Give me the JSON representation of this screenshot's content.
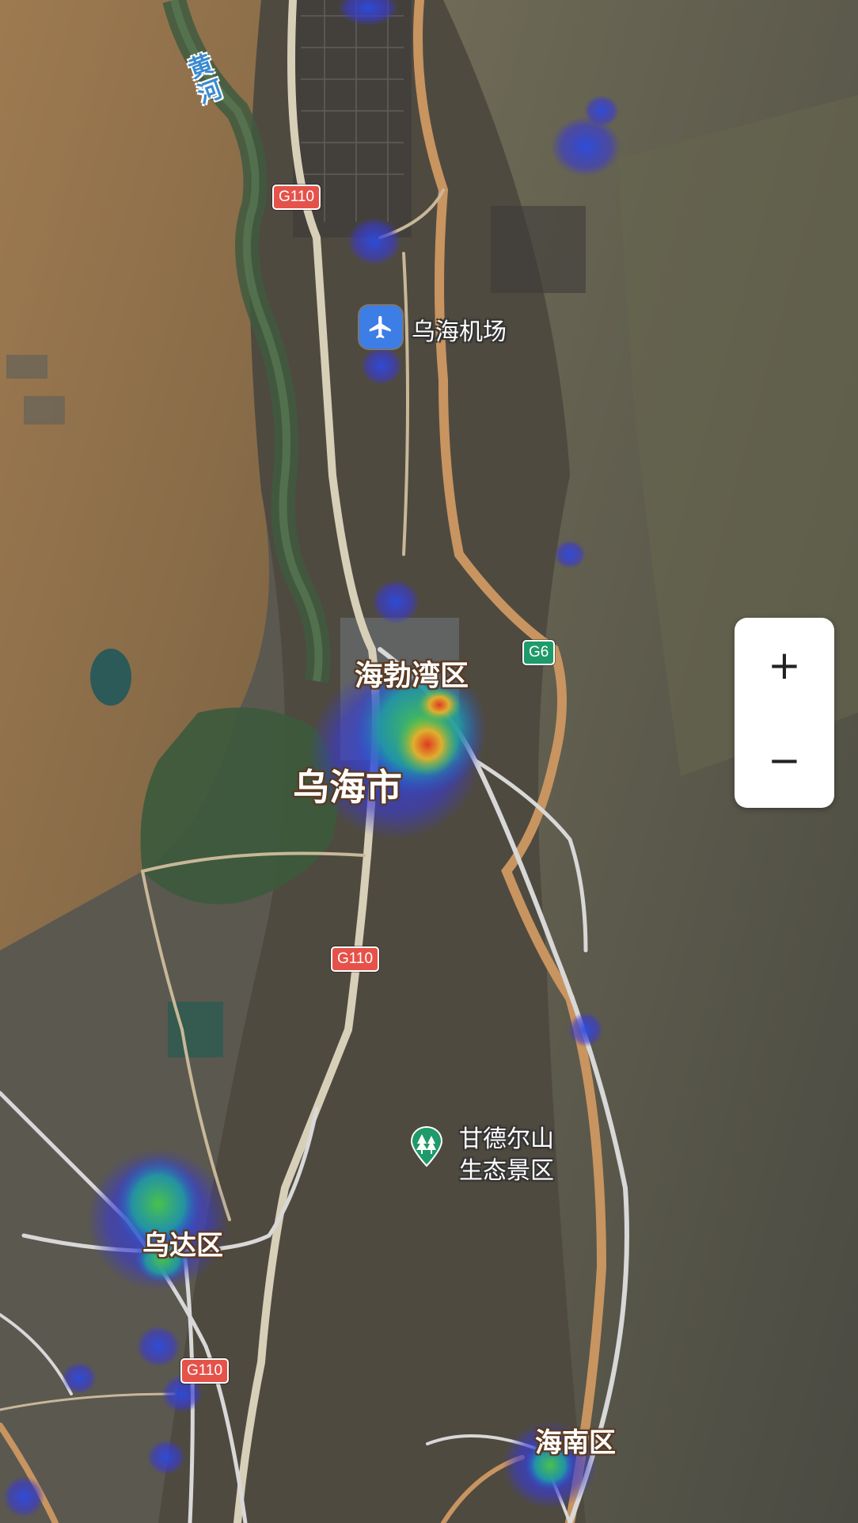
{
  "map": {
    "style": "satellite",
    "river": {
      "name": "黄河",
      "color": "#3a8ad0"
    },
    "places": {
      "city": "乌海市",
      "haibowan": "海勃湾区",
      "wuda": "乌达区",
      "hainan": "海南区"
    },
    "pois": {
      "airport": {
        "label": "乌海机场",
        "icon": "airplane-icon",
        "color": "#3d7de6"
      },
      "scenic": {
        "label_line1": "甘德尔山",
        "label_line2": "生态景区",
        "icon": "tree-pin-icon",
        "color": "#1f9a6a"
      }
    },
    "road_shields": [
      {
        "id": "g110-north",
        "label": "G110",
        "color": "#e5524a"
      },
      {
        "id": "g6",
        "label": "G6",
        "color": "#1f9a6a"
      },
      {
        "id": "g110-middle",
        "label": "G110",
        "color": "#e5524a"
      },
      {
        "id": "g110-south",
        "label": "G110",
        "color": "#e5524a"
      }
    ],
    "heatmap": {
      "colors": [
        "#3b3bd6",
        "#1fa0a0",
        "#4ac24a",
        "#e8b02a",
        "#e03a20"
      ]
    }
  },
  "controls": {
    "zoom_in": "+",
    "zoom_out": "−"
  }
}
